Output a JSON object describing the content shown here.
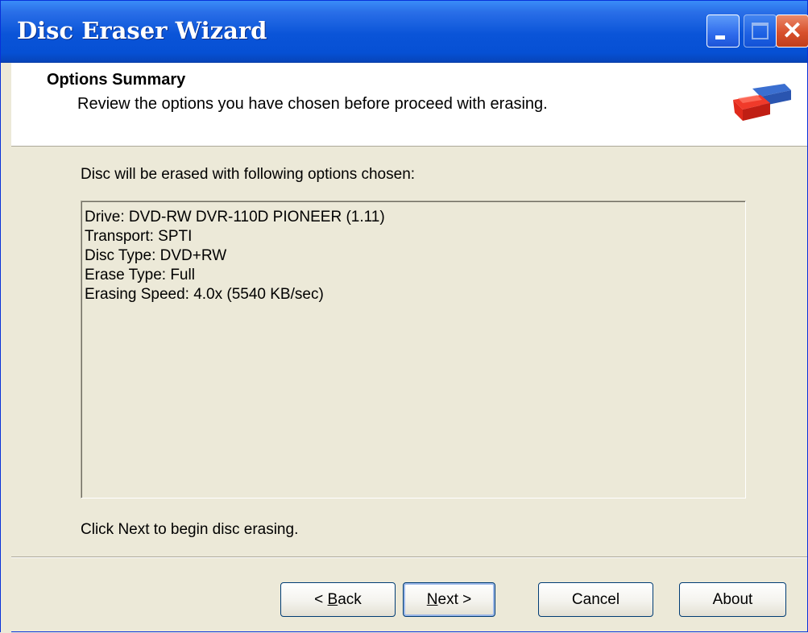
{
  "window": {
    "title": "Disc Eraser Wizard",
    "controls": {
      "minimize": "minimize-icon",
      "maximize": "maximize-icon",
      "close": "close-icon"
    }
  },
  "header": {
    "title": "Options Summary",
    "subtitle": "Review the options you have chosen before proceed with erasing.",
    "icon": "eraser-icon"
  },
  "main": {
    "intro": "Disc will be erased with following options chosen:",
    "summary_lines": [
      "Drive: DVD-RW  DVR-110D PIONEER  (1.11)",
      "Transport: SPTI",
      "Disc Type: DVD+RW",
      "Erase Type: Full",
      "Erasing Speed: 4.0x (5540 KB/sec)"
    ],
    "footer_note": "Click Next to begin disc erasing."
  },
  "buttons": {
    "back": {
      "prefix": "< ",
      "accel": "B",
      "rest": "ack"
    },
    "next": {
      "accel": "N",
      "rest": "ext >"
    },
    "cancel": "Cancel",
    "about": "About"
  },
  "colors": {
    "titlebar": "#0a54d8",
    "dialog_bg": "#ece9d8",
    "header_bg": "#ffffff",
    "close_button": "#d8502c"
  }
}
